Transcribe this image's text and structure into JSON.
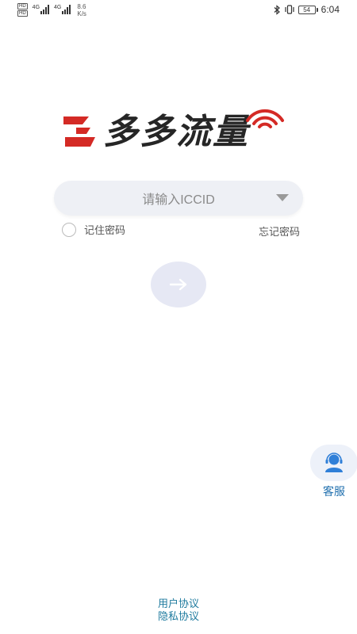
{
  "status_bar": {
    "hd_badges": [
      "HD",
      "HD"
    ],
    "sim1_tech": "4G",
    "sim2_tech": "4G",
    "net_speed_value": "8.6",
    "net_speed_unit": "K/s",
    "battery_level": "54",
    "time": "6:04",
    "icons": [
      "bluetooth-icon",
      "vibrate-icon",
      "battery-icon",
      "signal-icon"
    ]
  },
  "logo": {
    "text": "多多流量",
    "colors": {
      "red": "#d42a25",
      "dark": "#262626"
    }
  },
  "login": {
    "iccid_placeholder": "请输入ICCID",
    "remember_label": "记住密码",
    "remember_checked": false,
    "forgot_label": "忘记密码",
    "submit_icon": "arrow-right-icon"
  },
  "customer_service": {
    "label": "客服",
    "icon": "agent-avatar-icon"
  },
  "footer": {
    "user_agreement": "用户协议",
    "privacy_agreement": "隐私协议"
  },
  "theme": {
    "link_color": "#1e7a9e",
    "input_bg": "#eef0f5",
    "button_bg": "#e6e8f4",
    "cs_icon_color": "#2f7fd8"
  }
}
